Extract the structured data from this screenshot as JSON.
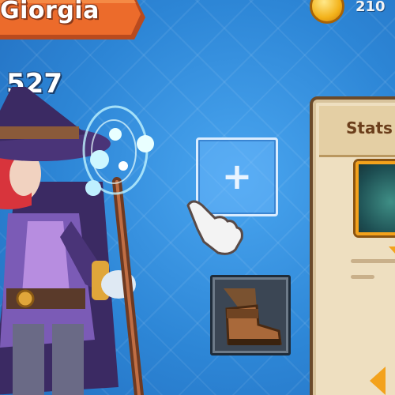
{
  "player": {
    "name": "Giorgia",
    "power": "527"
  },
  "currency": {
    "coins": "210",
    "icon": "coin-icon"
  },
  "equipment": {
    "add_slot_label": "+",
    "boots_icon": "boots-icon"
  },
  "stats_panel": {
    "title": "Stats"
  },
  "colors": {
    "background": "#2f8ad8",
    "banner": "#e8672a",
    "panel": "#eedfc0",
    "accent": "#f3a21c"
  }
}
